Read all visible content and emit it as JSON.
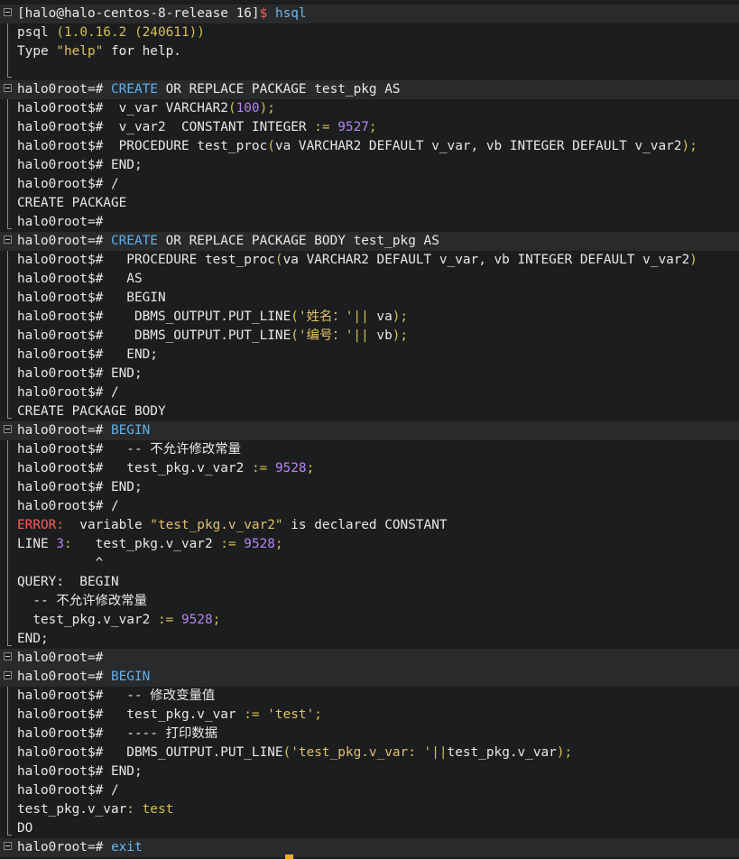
{
  "terminal": {
    "shell": {
      "user_host": "[halo@halo-centos-8-release 16]",
      "sym": "$",
      "command": "hsql"
    },
    "banner": {
      "psql": "psql",
      "version": "(1.0.16.2 (240611))",
      "type_word": "Type",
      "help_str": "\"help\"",
      "for_help": "for help."
    },
    "prompt_main": "halo0root=#",
    "prompt_cont": "halo0root$#",
    "blocks": {
      "spec": {
        "line1": {
          "kw": "CREATE",
          "rest": " OR REPLACE PACKAGE test_pkg AS"
        },
        "line2": {
          "a": "  v_var VARCHAR2",
          "p1": "(",
          "n": "100",
          "p2": ");"
        },
        "line3": {
          "a": "  v_var2  CONSTANT INTEGER ",
          "op": ":=",
          "sp": " ",
          "n": "9527",
          "p": ";"
        },
        "line4": {
          "a": "  PROCEDURE test_proc",
          "p1": "(",
          "b": "va VARCHAR2 DEFAULT v_var, vb INTEGER DEFAULT v_var2",
          "p2": ");"
        },
        "line5": " END;",
        "line6": " /",
        "result": "CREATE PACKAGE"
      },
      "body": {
        "line1": {
          "kw": "CREATE",
          "rest": " OR REPLACE PACKAGE BODY test_pkg AS"
        },
        "line2": {
          "a": "   PROCEDURE test_proc",
          "p1": "(",
          "b": "va VARCHAR2 DEFAULT v_var, vb INTEGER DEFAULT v_var2",
          "p2": ")"
        },
        "line3": "   AS",
        "line4": "   BEGIN",
        "line5": {
          "a": "    DBMS_OUTPUT.PUT_LINE",
          "p1": "(",
          "s": "'姓名：'",
          "op": "||",
          "b": " va",
          "p2": ");"
        },
        "line6": {
          "a": "    DBMS_OUTPUT.PUT_LINE",
          "p1": "(",
          "s": "'编号：'",
          "op": "||",
          "b": " vb",
          "p2": ");"
        },
        "line7": "   END;",
        "line8": " END;",
        "line9": " /",
        "result": "CREATE PACKAGE BODY"
      },
      "anon1": {
        "line1": "BEGIN",
        "line2": "   -- 不允许修改常量",
        "line3": {
          "a": "   test_pkg.v_var2 ",
          "op": ":=",
          "sp": " ",
          "n": "9528",
          "p": ";"
        },
        "line4": " END;",
        "line5": " /",
        "err_label": "ERROR:",
        "err_msg": "  variable ",
        "err_str": "\"test_pkg.v_var2\"",
        "err_tail": " is declared CONSTANT",
        "line_label": "LINE ",
        "line_no": "3",
        "line_colon": ":",
        "line_code": "   test_pkg.v_var2 ",
        "line_op": ":=",
        "line_n": "9528",
        "line_p": ";",
        "caret": "          ^",
        "query_label": "QUERY:",
        "query_begin": "  BEGIN",
        "q2": "  -- 不允许修改常量",
        "q3": {
          "a": "  test_pkg.v_var2 ",
          "op": ":=",
          "n": "9528",
          "p": ";"
        },
        "q4": "END;"
      },
      "anon2": {
        "line1": "BEGIN",
        "line2": "   -- 修改变量值",
        "line3": {
          "a": "   test_pkg.v_var ",
          "op": ":=",
          "sp": " ",
          "s": "'test'",
          "p": ";"
        },
        "line4": "   ---- 打印数据",
        "line5": {
          "a": "   DBMS_OUTPUT.PUT_LINE",
          "p1": "(",
          "s": "'test_pkg.v_var: '",
          "op": "||",
          "b": "test_pkg.v_var",
          "p2": ");"
        },
        "line6": " END;",
        "line7": " /",
        "out_a": "test_pkg.v_var",
        "out_b": ": test",
        "done": "DO"
      }
    },
    "last_command": "exit",
    "colors": {
      "background": "#1b1d1e",
      "keyword": "#5fb0ea",
      "string": "#e3c069",
      "number": "#b584f5",
      "error": "#ff5c57",
      "cursor": "#f0a830"
    }
  }
}
